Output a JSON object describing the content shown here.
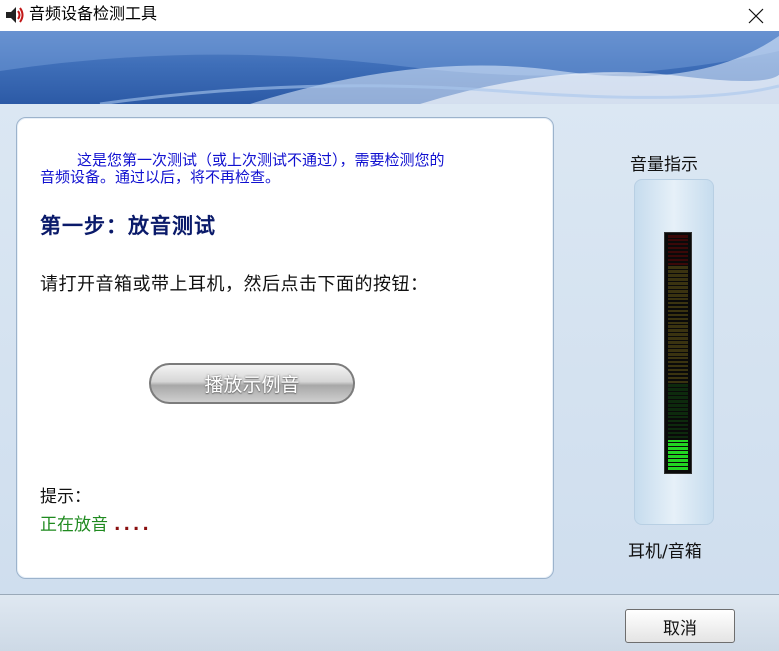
{
  "window": {
    "title": "音频设备检测工具",
    "icon": "speaker-app-icon",
    "close_icon": "close-icon"
  },
  "content": {
    "intro_line1": "这是您第一次测试（或上次测试不通过），需要检测您的",
    "intro_line2": "音频设备。通过以后，将不再检查。",
    "step_title": "第一步：放音测试",
    "instruction": "请打开音箱或带上耳机，然后点击下面的按钮：",
    "play_button": "播放示例音",
    "hint_label": "提示：",
    "status_text": "正在放音",
    "status_dots": "...."
  },
  "meter": {
    "title": "音量指示",
    "label": "耳机/音箱",
    "total_segments": 60,
    "active_segments": 8,
    "colors": {
      "dim_red": "#3a0808",
      "dim_yellow": "#3a3310",
      "dim_green": "#0d2a0d",
      "active_green": "#22d622"
    }
  },
  "footer": {
    "cancel_button": "取消"
  },
  "colors": {
    "intro_text": "#1010d0",
    "step_title": "#0a1a6a",
    "status_green": "#1f8a1f",
    "status_dots": "#8a1010"
  }
}
